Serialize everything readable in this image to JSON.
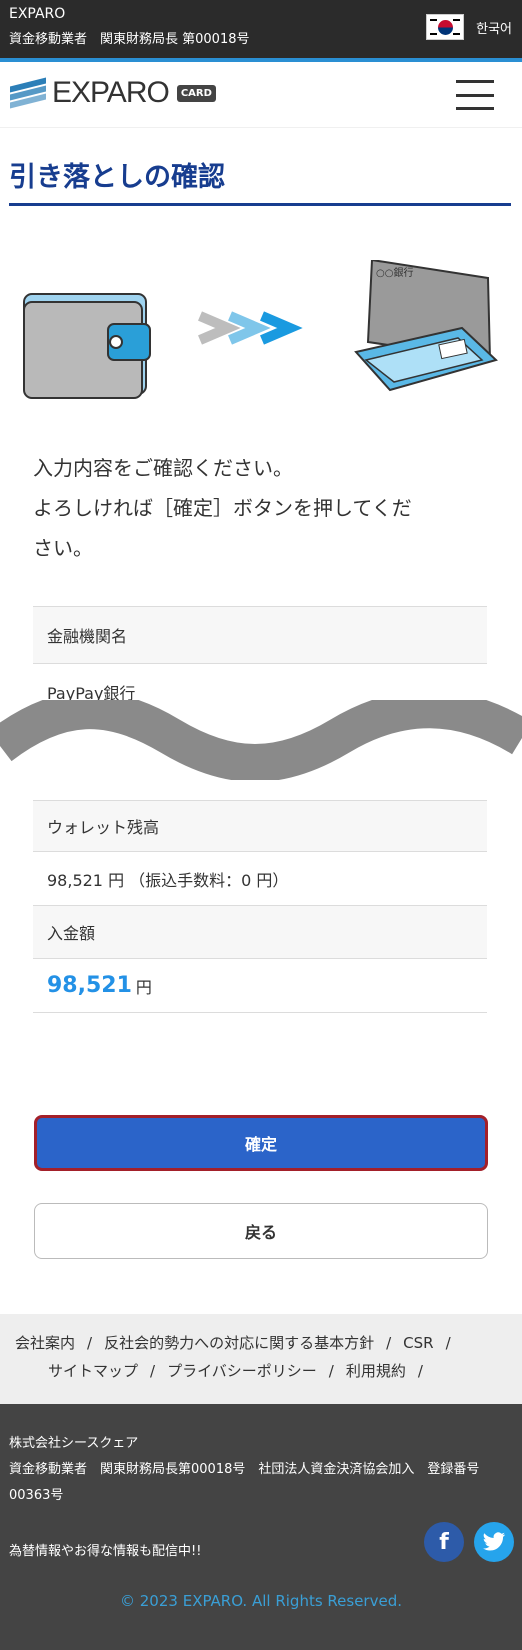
{
  "topbar": {
    "brand": "EXPARO",
    "license": "資金移動業者　関東財務局長 第00018号",
    "language": "한국어",
    "flag_icon": "korea-flag-icon"
  },
  "header": {
    "logo_text": "EXPARO",
    "logo_badge": "CARD",
    "menu_icon": "hamburger-menu-icon"
  },
  "page": {
    "title": "引き落としの確認",
    "message_line1": "入力内容をご確認ください。",
    "message_line2": "よろしければ［確定］ボタンを押してくだ",
    "message_line3": "さい。"
  },
  "fields": {
    "bank_label": "金融機関名",
    "bank_value": "PayPay銀行",
    "wallet_label": "ウォレット残高",
    "wallet_value": "98,521 円 （振込手数料：0 円）",
    "deposit_label": "入金額",
    "deposit_amount": "98,521",
    "deposit_unit": "円"
  },
  "buttons": {
    "confirm": "確定",
    "back": "戻る"
  },
  "footer_nav": {
    "items": [
      "会社案内",
      "反社会的勢力への対応に関する基本方針",
      "CSR",
      "サイトマップ",
      "プライバシーポリシー",
      "利用規約"
    ],
    "separator": "/"
  },
  "footer": {
    "company": "株式会社シースクェア",
    "registration": "資金移動業者　関東財務局長第00018号　社団法人資金決済協会加入　登録番号00363号",
    "promo": "為替情報やお得な情報も配信中!!",
    "facebook_icon": "f",
    "twitter_icon": "twitter-bird-icon",
    "copyright": "© 2023 EXPARO. All Rights Reserved."
  },
  "colors": {
    "title": "#173d8f",
    "primary_button": "#2b64c9",
    "primary_border": "#a3202a",
    "amount": "#2391e6",
    "footer_bg": "#444444"
  }
}
